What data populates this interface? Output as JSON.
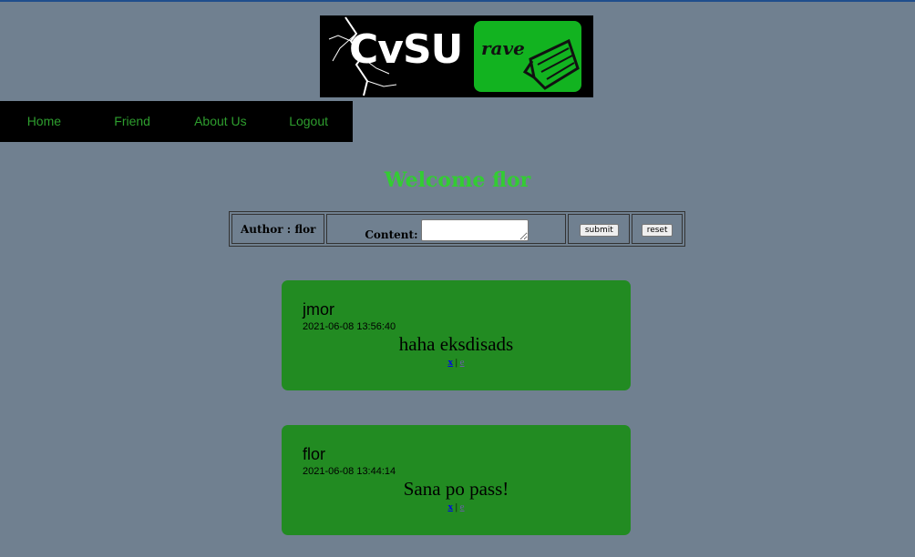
{
  "logo": {
    "title": "CvSU",
    "badge_text": "rave",
    "badge_color": "#12b320",
    "icon": "folder-icon"
  },
  "nav": {
    "items": [
      {
        "label": "Home"
      },
      {
        "label": "Friend"
      },
      {
        "label": "About Us"
      },
      {
        "label": "Logout"
      }
    ],
    "color": "#2e9e2e"
  },
  "welcome": "Welcome flor",
  "form": {
    "author_label": "Author : flor",
    "content_label": "Content:",
    "content_value": "",
    "submit_label": "submit",
    "reset_label": "reset"
  },
  "posts": [
    {
      "author": "jmor",
      "date": "2021-06-08 13:56:40",
      "content": "haha eksdisads",
      "delete_label": "x",
      "separator": "|",
      "edit_label": "e"
    },
    {
      "author": "flor",
      "date": "2021-06-08 13:44:14",
      "content": "Sana po pass!",
      "delete_label": "x",
      "separator": "|",
      "edit_label": "e"
    }
  ],
  "colors": {
    "background": "#708090",
    "post_background": "#228b22",
    "welcome": "#33cc33"
  }
}
